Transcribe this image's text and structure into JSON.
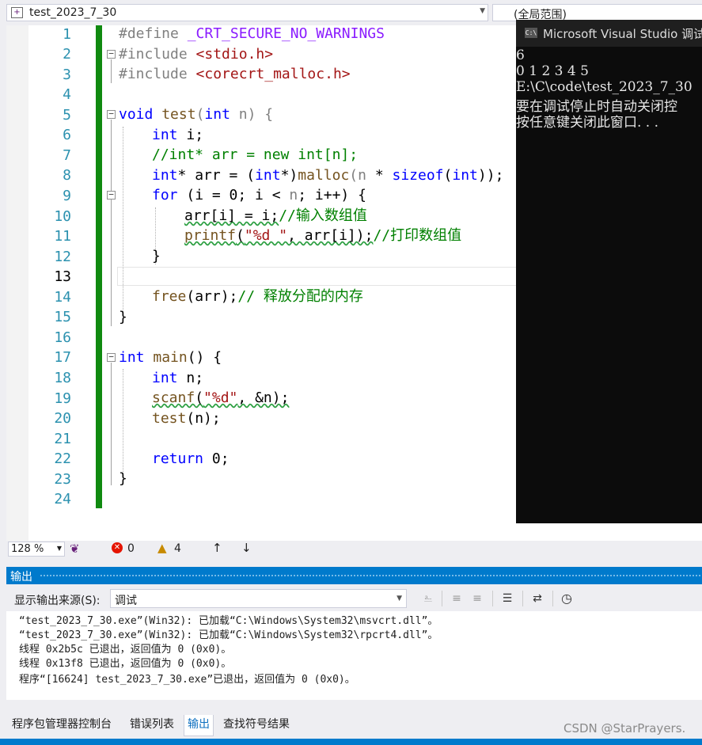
{
  "nav": {
    "project_dropdown": "test_2023_7_30",
    "scope_dropdown": "(全局范围)"
  },
  "editor": {
    "line_numbers": [
      "1",
      "2",
      "3",
      "4",
      "5",
      "6",
      "7",
      "8",
      "9",
      "10",
      "11",
      "12",
      "13",
      "14",
      "15",
      "16",
      "17",
      "18",
      "19",
      "20",
      "21",
      "22",
      "23",
      "24"
    ],
    "current_line": "13",
    "zoom": "128 %",
    "errors": "0",
    "warnings": "4",
    "code": {
      "l1_define": "#define",
      "l1_macro": "_CRT_SECURE_NO_WARNINGS",
      "l2_include": "#include",
      "l2_header": "<stdio.h>",
      "l3_include": "#include",
      "l3_header": "<corecrt_malloc.h>",
      "l5_void": "void",
      "l5_name": "test",
      "l5_open": "(",
      "l5_int": "int",
      "l5_param": "n",
      "l5_close": ") {",
      "l6_int": "int",
      "l6_rest": " i;",
      "l7_comment": "//int* arr = new int[n];",
      "l8_int": "int",
      "l8_a": "* arr = (",
      "l8_int2": "int",
      "l8_b": "*)",
      "l8_malloc": "malloc",
      "l8_c": "(",
      "l8_n": "n",
      "l8_d": " * ",
      "l8_sizeof": "sizeof",
      "l8_e": "(",
      "l8_int3": "int",
      "l8_f": "));",
      "l9_for": "for",
      "l9_a": " (i = 0; i < ",
      "l9_n": "n",
      "l9_b": "; i++) {",
      "l10_code": "arr[i] = i;",
      "l10_comment": "//输入数组值",
      "l11_printf": "printf",
      "l11_open": "(",
      "l11_str": "\"%d \"",
      "l11_rest": ", arr[i]);",
      "l11_comment": "//打印数组值",
      "l12": "}",
      "l14_free": "free",
      "l14_rest": "(arr);",
      "l14_comment": "// 释放分配的内存",
      "l15": "}",
      "l17_int": "int",
      "l17_main": " main",
      "l17_rest": "() {",
      "l18_int": "int",
      "l18_rest": " n;",
      "l19_scanf": "scanf",
      "l19_open": "(",
      "l19_str": "\"%d\"",
      "l19_rest": ", &n);",
      "l20_test": "test",
      "l20_rest": "(n);",
      "l22_return": "return",
      "l22_rest": " 0;",
      "l23": "}"
    }
  },
  "console": {
    "title": "Microsoft Visual Studio 调试",
    "icon": "C:\\",
    "lines": [
      "6",
      "0 1 2 3 4 5",
      "E:\\C\\code\\test_2023_7_30",
      "要在调试停止时自动关闭控",
      "按任意键关闭此窗口. . ."
    ]
  },
  "output": {
    "title": "输出",
    "source_label": "显示输出来源(S):",
    "source_value": "调试",
    "lines": [
      "“test_2023_7_30.exe”(Win32): 已加载“C:\\Windows\\System32\\msvcrt.dll”。",
      "“test_2023_7_30.exe”(Win32): 已加载“C:\\Windows\\System32\\rpcrt4.dll”。",
      "线程 0x2b5c 已退出，返回值为 0 (0x0)。",
      "线程 0x13f8 已退出，返回值为 0 (0x0)。",
      "程序“[16624] test_2023_7_30.exe”已退出，返回值为 0 (0x0)。"
    ]
  },
  "tabs": [
    "程序包管理器控制台",
    "错误列表",
    "输出",
    "查找符号结果"
  ],
  "watermark": "CSDN @StarPrayers.",
  "colors": {
    "accent": "#007acc",
    "change_bar": "#108a10",
    "keyword": "#0000ff",
    "comment": "#008000",
    "string": "#a31515",
    "macro": "#8a1bff"
  },
  "icons": [
    "file-scope-icon",
    "console-app-icon",
    "intellicode-icon",
    "error-icon",
    "warning-icon",
    "arrow-up-icon",
    "arrow-down-icon",
    "clear-all-icon",
    "word-wrap-icon",
    "clock-icon"
  ]
}
